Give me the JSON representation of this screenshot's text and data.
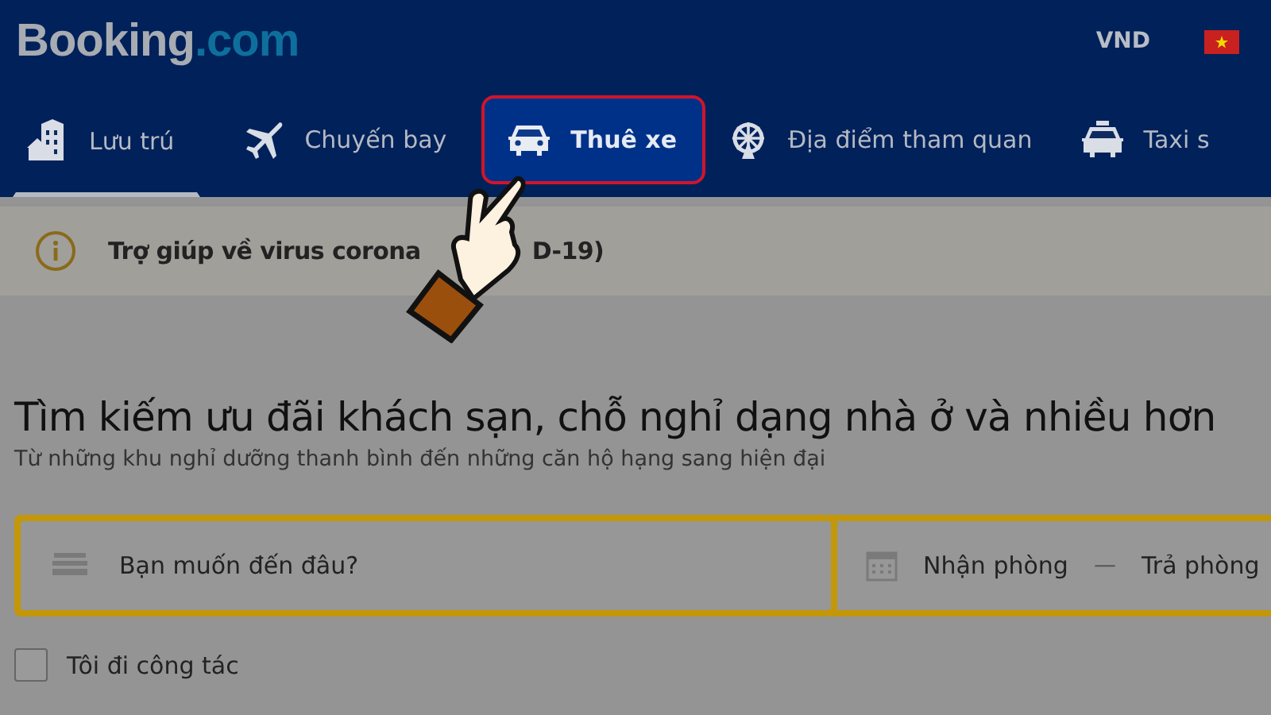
{
  "header": {
    "logo": {
      "brand": "Booking",
      "suffix": ".com"
    },
    "currency": "VND"
  },
  "tabs": [
    {
      "label": "Lưu trú",
      "kind": "stay",
      "selected": true,
      "highlighted": false
    },
    {
      "label": "Chuyến bay",
      "kind": "flight",
      "selected": false,
      "highlighted": false
    },
    {
      "label": "Thuê xe",
      "kind": "car",
      "selected": false,
      "highlighted": true
    },
    {
      "label": "Địa điểm tham quan",
      "kind": "attraction",
      "selected": false,
      "highlighted": false
    },
    {
      "label": "Taxi s",
      "kind": "taxi",
      "selected": false,
      "highlighted": false
    }
  ],
  "notice": {
    "text_before": "Trợ giúp về virus corona",
    "text_after": "D-19)"
  },
  "hero": {
    "title": "Tìm kiếm ưu đãi khách sạn, chỗ nghỉ dạng nhà ở và nhiều hơn",
    "subtitle": "Từ những khu nghỉ dưỡng thanh bình đến những căn hộ hạng sang hiện đại"
  },
  "search": {
    "destination_placeholder": "Bạn muốn đến đâu?",
    "checkin": "Nhận phòng",
    "separator": "—",
    "checkout": "Trả phòng"
  },
  "business_trip": {
    "label": "Tôi đi công tác",
    "checked": false
  }
}
